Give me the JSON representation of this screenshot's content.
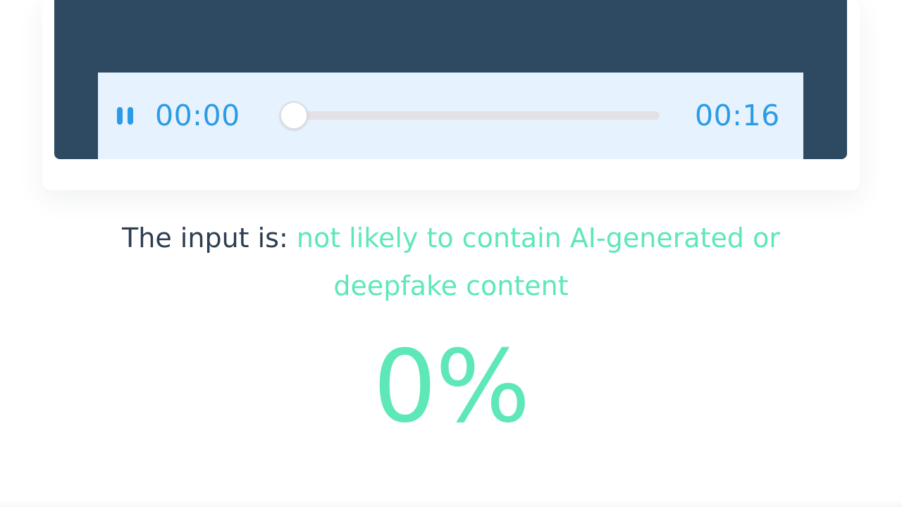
{
  "player": {
    "current_time": "00:00",
    "total_time": "00:16",
    "progress": 0,
    "state": "playing",
    "pause_icon": "pause-icon"
  },
  "result": {
    "prefix": "The input is: ",
    "verdict": "not likely to contain AI-generated or deepfake content",
    "score": "0%"
  },
  "colors": {
    "panel": "#2d4a62",
    "player_bg": "#e6f2fe",
    "accent_blue": "#2b9be6",
    "accent_green": "#5ee8b7",
    "text_dark": "#2c3e50"
  }
}
